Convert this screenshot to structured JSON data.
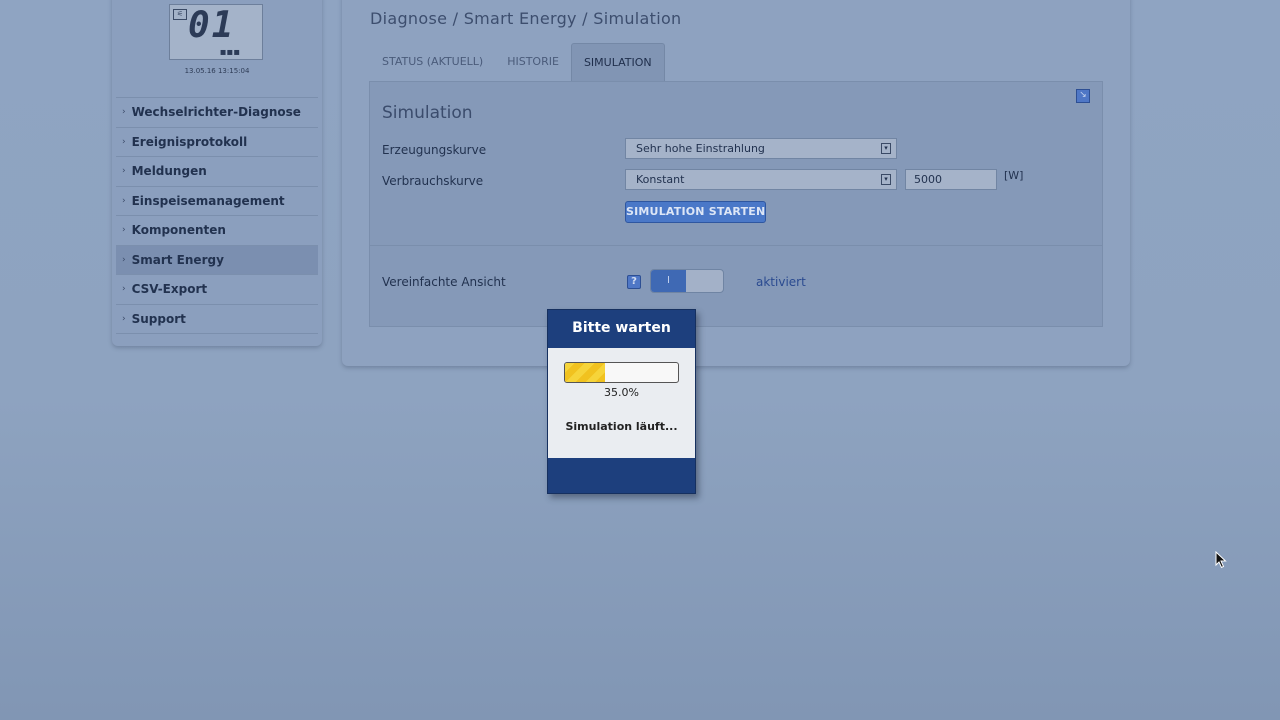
{
  "sidebar": {
    "lcd": {
      "digits": "01",
      "mini_icon": "⚟",
      "dots": "▪▪▪"
    },
    "timestamp": "13.05.16 13:15:04",
    "items": [
      {
        "label": "Wechselrichter-Diagnose"
      },
      {
        "label": "Ereignisprotokoll"
      },
      {
        "label": "Meldungen"
      },
      {
        "label": "Einspeisemanagement"
      },
      {
        "label": "Komponenten"
      },
      {
        "label": "Smart Energy",
        "active": true
      },
      {
        "label": "CSV-Export"
      },
      {
        "label": "Support"
      }
    ]
  },
  "main": {
    "breadcrumb": "Diagnose / Smart Energy / Simulation",
    "tabs": [
      {
        "label": "STATUS (AKTUELL)"
      },
      {
        "label": "HISTORIE"
      },
      {
        "label": "SIMULATION",
        "active": true
      }
    ],
    "section_title": "Simulation",
    "form": {
      "generation_label": "Erzeugungskurve",
      "generation_value": "Sehr hohe Einstrahlung",
      "consumption_label": "Verbrauchskurve",
      "consumption_value": "Konstant",
      "power_value": "5000",
      "power_unit": "[W]",
      "start_button": "SIMULATION STARTEN"
    },
    "simplified_view": {
      "label": "Vereinfachte Ansicht",
      "help": "?",
      "toggle_on_label": "I",
      "status": "aktiviert"
    }
  },
  "modal": {
    "title": "Bitte warten",
    "progress_fraction": 0.35,
    "progress_text": "35.0%",
    "status": "Simulation läuft..."
  },
  "colors": {
    "accent": "#4a78c8",
    "modal_header": "#1d3f7d",
    "progress_fill": "#f6d43a"
  }
}
